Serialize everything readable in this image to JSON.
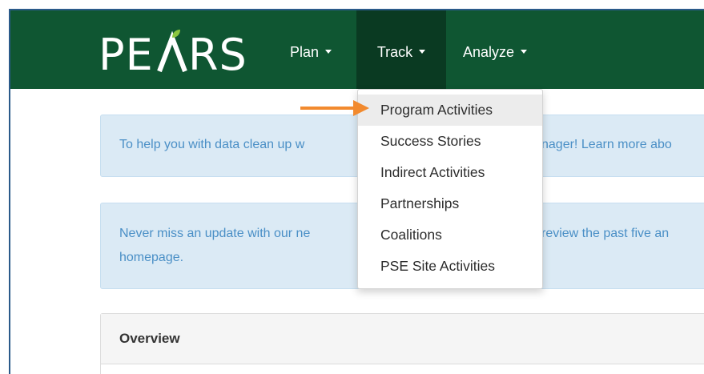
{
  "navbar": {
    "logo": "PEARS",
    "menus": [
      {
        "label": "Plan"
      },
      {
        "label": "Track"
      },
      {
        "label": "Analyze"
      }
    ],
    "color": "#0f5632",
    "active_color": "#0a3a22"
  },
  "track_menu": {
    "items": [
      {
        "label": "Program Activities"
      },
      {
        "label": "Success Stories"
      },
      {
        "label": "Indirect Activities"
      },
      {
        "label": "Partnerships"
      },
      {
        "label": "Coalitions"
      },
      {
        "label": "PSE Site Activities"
      }
    ]
  },
  "alerts": [
    {
      "left": "To help you with data clean up w",
      "right": "nager!  Learn more abo"
    },
    {
      "left": "Never miss an update with our ne",
      "right": "review the past five an",
      "line2": "homepage."
    }
  ],
  "panel": {
    "title": "Overview"
  },
  "annotation": {
    "arrow_color": "#f28a2e"
  }
}
